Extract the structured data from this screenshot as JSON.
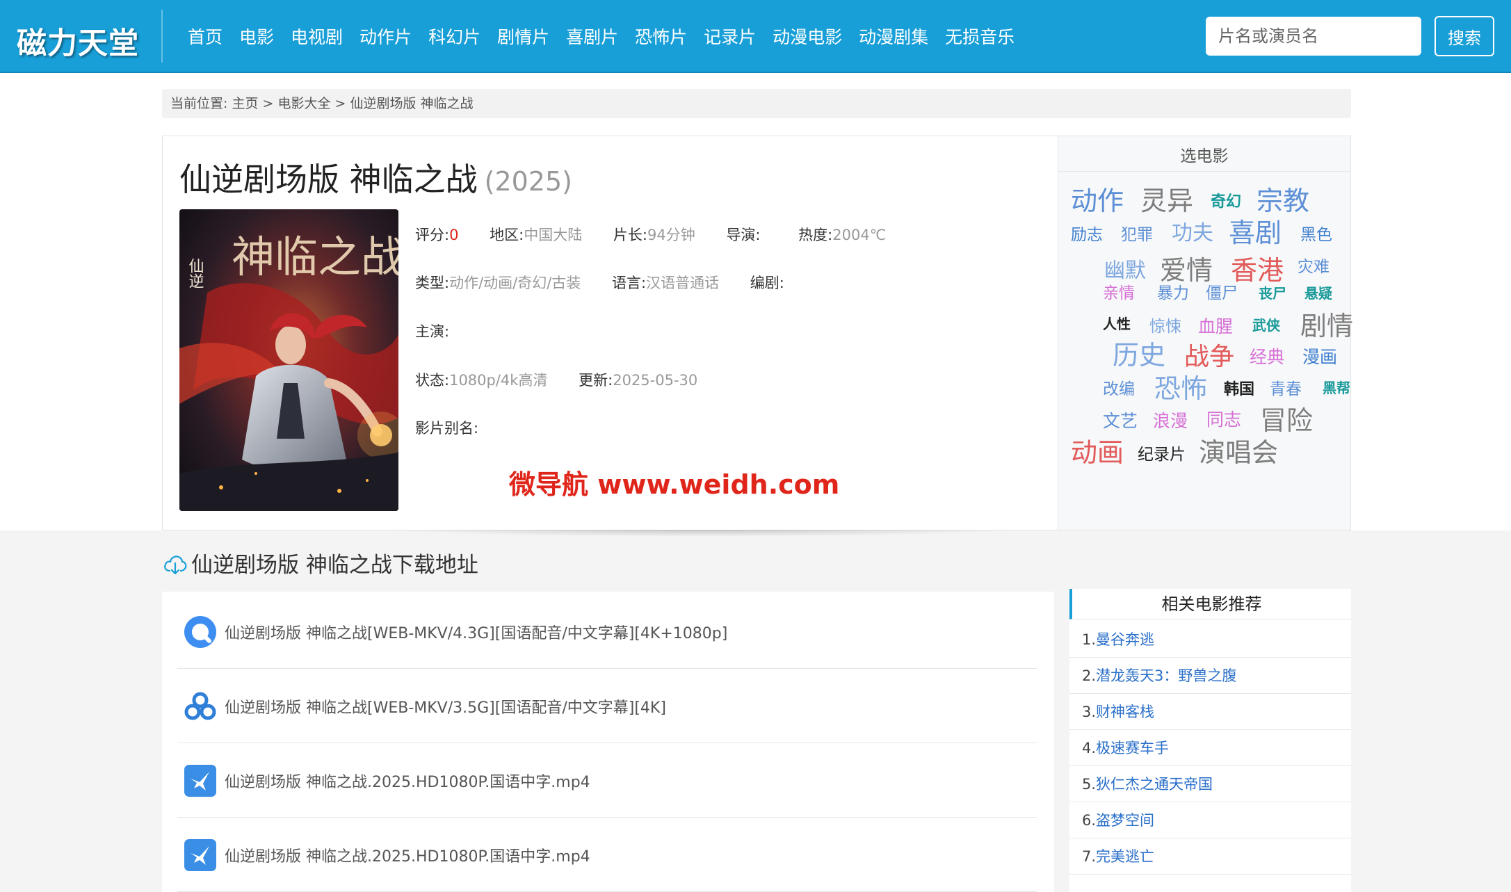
{
  "header": {
    "logo": "磁力天堂",
    "nav": [
      "首页",
      "电影",
      "电视剧",
      "动作片",
      "科幻片",
      "剧情片",
      "喜剧片",
      "恐怖片",
      "记录片",
      "动漫电影",
      "动漫剧集",
      "无损音乐"
    ],
    "search_placeholder": "片名或演员名",
    "search_button": "搜索"
  },
  "breadcrumb": {
    "prefix": "当前位置:",
    "home": "主页",
    "sep1": ">",
    "category": "电影大全",
    "sep2": ">",
    "current": "仙逆剧场版 神临之战"
  },
  "movie": {
    "title": "仙逆剧场版 神临之战",
    "year": "(2025)",
    "poster_text": "神临之战",
    "poster_side": "仙逆",
    "fields": {
      "rating_label": "评分:",
      "rating": "0",
      "region_label": "地区:",
      "region": "中国大陆",
      "duration_label": "片长:",
      "duration": "94分钟",
      "director_label": "导演:",
      "heat_label": "热度:",
      "heat": "2004℃",
      "genre_label": "类型:",
      "genre": "动作/动画/奇幻/古装",
      "language_label": "语言:",
      "language": "汉语普通话",
      "writer_label": "编剧:",
      "cast_label": "主演:",
      "status_label": "状态:",
      "status": "1080p/4k高清",
      "updated_label": "更新:",
      "updated": "2025-05-30",
      "alias_label": "影片别名:"
    },
    "watermark": "微导航 www.weidh.com"
  },
  "tag_cloud": {
    "title": "选电影",
    "tags": [
      {
        "t": "动作",
        "c": "#5c8fd6"
      },
      {
        "t": "灵异",
        "c": "#7d7d7d"
      },
      {
        "t": "奇幻",
        "c": "#1a9a9a"
      },
      {
        "t": "宗教",
        "c": "#5c8fd6"
      },
      {
        "t": "励志",
        "c": "#3f7fd0"
      },
      {
        "t": "犯罪",
        "c": "#5c8fd6"
      },
      {
        "t": "功夫",
        "c": "#7ea7e0"
      },
      {
        "t": "喜剧",
        "c": "#5c8fd6"
      },
      {
        "t": "黑色",
        "c": "#3f7fd0"
      },
      {
        "t": "幽默",
        "c": "#7ea7e0"
      },
      {
        "t": "爱情",
        "c": "#7d7d7d"
      },
      {
        "t": "香港",
        "c": "#e25a5a"
      },
      {
        "t": "灾难",
        "c": "#5c8fd6"
      },
      {
        "t": "亲情",
        "c": "#d66fd6"
      },
      {
        "t": "暴力",
        "c": "#5c8fd6"
      },
      {
        "t": "僵尸",
        "c": "#5c8fd6"
      },
      {
        "t": "丧尸",
        "c": "#1a9a9a"
      },
      {
        "t": "悬疑",
        "c": "#1a9a9a"
      },
      {
        "t": "人性",
        "c": "#222222"
      },
      {
        "t": "惊悚",
        "c": "#7ea7e0"
      },
      {
        "t": "血腥",
        "c": "#d66fd6"
      },
      {
        "t": "武侠",
        "c": "#1a9a9a"
      },
      {
        "t": "剧情",
        "c": "#7d7d7d"
      },
      {
        "t": "历史",
        "c": "#7ea7e0"
      },
      {
        "t": "战争",
        "c": "#e25a5a"
      },
      {
        "t": "经典",
        "c": "#d66fd6"
      },
      {
        "t": "漫画",
        "c": "#3f7fd0"
      },
      {
        "t": "改编",
        "c": "#5c8fd6"
      },
      {
        "t": "恐怖",
        "c": "#7ea7e0"
      },
      {
        "t": "韩国",
        "c": "#222222"
      },
      {
        "t": "青春",
        "c": "#5c8fd6"
      },
      {
        "t": "黑帮",
        "c": "#1a9a9a"
      },
      {
        "t": "文艺",
        "c": "#5c8fd6"
      },
      {
        "t": "浪漫",
        "c": "#d66fd6"
      },
      {
        "t": "同志",
        "c": "#d66fd6"
      },
      {
        "t": "冒险",
        "c": "#7d7d7d"
      },
      {
        "t": "动画",
        "c": "#e25a5a"
      },
      {
        "t": "纪录片",
        "c": "#222222"
      },
      {
        "t": "演唱会",
        "c": "#7d7d7d"
      }
    ]
  },
  "downloads": {
    "heading": "仙逆剧场版 神临之战下载地址",
    "items": [
      {
        "icon": "quark-icon",
        "text": "仙逆剧场版 神临之战[WEB-MKV/4.3G][国语配音/中文字幕][4K+1080p]"
      },
      {
        "icon": "baidu-cloud-icon",
        "text": "仙逆剧场版 神临之战[WEB-MKV/3.5G][国语配音/中文字幕][4K]"
      },
      {
        "icon": "xunlei-bird-icon",
        "text": "仙逆剧场版 神临之战.2025.HD1080P.国语中字.mp4"
      },
      {
        "icon": "xunlei-bird-icon",
        "text": "仙逆剧场版 神临之战.2025.HD1080P.国语中字.mp4"
      }
    ]
  },
  "related": {
    "title": "相关电影推荐",
    "items": [
      {
        "n": "1.",
        "t": "曼谷奔逃"
      },
      {
        "n": "2.",
        "t": "潜龙轰天3：野兽之腹"
      },
      {
        "n": "3.",
        "t": "财神客栈"
      },
      {
        "n": "4.",
        "t": "极速赛车手"
      },
      {
        "n": "5.",
        "t": "狄仁杰之通天帝国"
      },
      {
        "n": "6.",
        "t": "盗梦空间"
      },
      {
        "n": "7.",
        "t": "完美逃亡"
      }
    ]
  },
  "colors": {
    "brand": "#189fd8",
    "accent_red": "#e0261b",
    "link": "#2a6fc9"
  }
}
